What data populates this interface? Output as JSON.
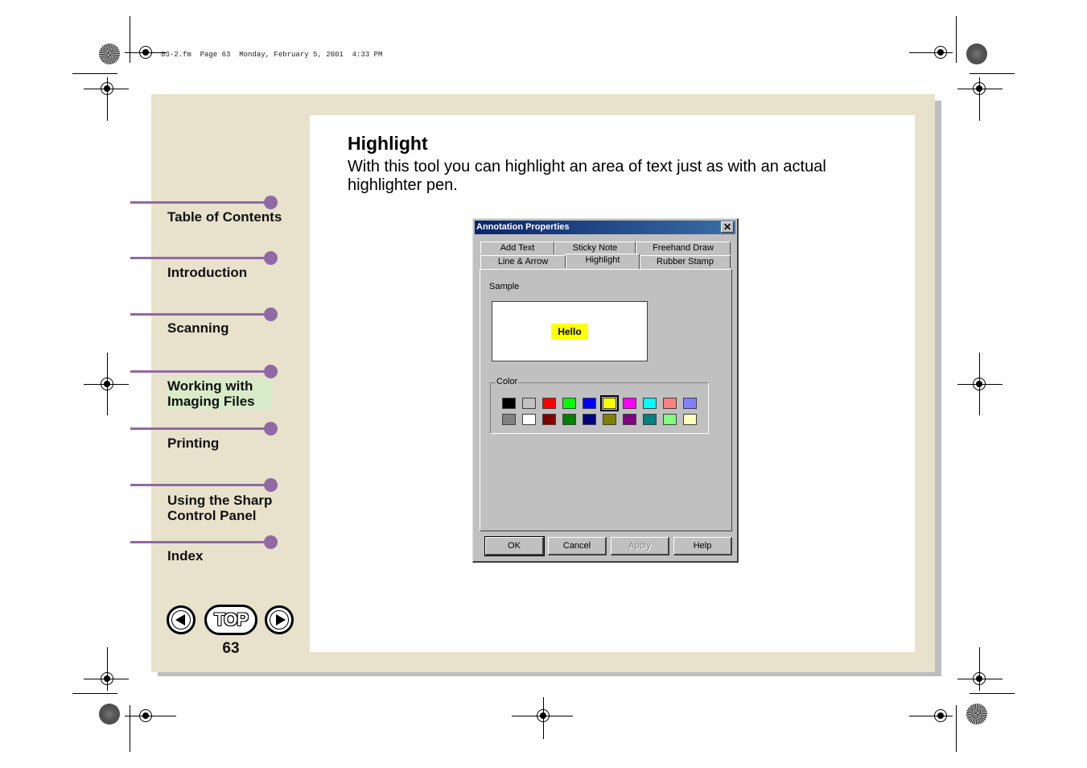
{
  "print_header": "03-2.fm  Page 63  Monday, February 5, 2001  4:33 PM",
  "nav": {
    "items": [
      {
        "label": "Table of Contents"
      },
      {
        "label": "Introduction"
      },
      {
        "label": "Scanning"
      },
      {
        "label": "Working with Imaging Files"
      },
      {
        "label": "Printing"
      },
      {
        "label": "Using the Sharp Control Panel"
      },
      {
        "label": "Index"
      }
    ],
    "top_label": "TOP",
    "page_number": "63",
    "prev_icon": "left-arrow-icon",
    "next_icon": "right-arrow-icon"
  },
  "main": {
    "title": "Highlight",
    "body": "With this tool you can highlight an area of text just as with an actual highlighter pen."
  },
  "dialog": {
    "title": "Annotation Properties",
    "close_icon": "close-icon",
    "tabs_row1": [
      "Add Text",
      "Sticky Note",
      "Freehand Draw"
    ],
    "tabs_row2": [
      "Line & Arrow",
      "Highlight",
      "Rubber Stamp"
    ],
    "active_tab": "Highlight",
    "sample_label": "Sample",
    "sample_text": "Hello",
    "color_label": "Color",
    "colors_row1": [
      "#000000",
      "#c0c0c0",
      "#ff0000",
      "#00ff00",
      "#0000ff",
      "#ffff00",
      "#ff00ff",
      "#00ffff",
      "#ff8080",
      "#8080ff"
    ],
    "colors_row2": [
      "#808080",
      "#ffffff",
      "#800000",
      "#008000",
      "#000080",
      "#808000",
      "#800080",
      "#008080",
      "#80ff80",
      "#ffffc0"
    ],
    "selected_color": "#ffff00",
    "buttons": {
      "ok": "OK",
      "cancel": "Cancel",
      "apply": "Apply",
      "help": "Help"
    }
  },
  "colors": {
    "frame_bg": "#e8e1cb",
    "nav_accent": "#8f6aa3",
    "highlight": "#ffff00"
  }
}
